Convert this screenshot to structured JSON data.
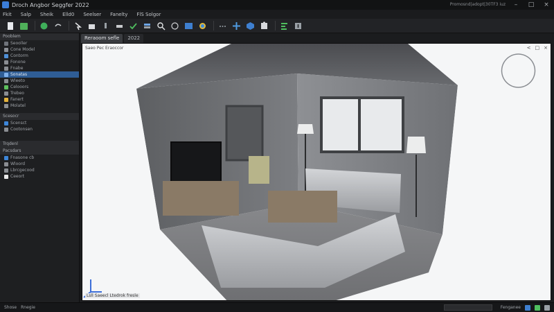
{
  "window": {
    "title": "Droch Angbor Seggfer 2022",
    "right_text": "Promosnd|adopt|30TF3 iuz"
  },
  "menu": {
    "items": [
      "Fkit",
      "Salp",
      "Sheik",
      "Elld0",
      "Seelser",
      "Fanelty",
      "FlS Solgor"
    ]
  },
  "sidebar": {
    "header1": "Pooblem",
    "rows_a": [
      {
        "label": "Seooller",
        "selected": false,
        "icon_color": "#6f737a"
      },
      {
        "label": "Cone Model",
        "selected": false,
        "icon_color": "#8d9096"
      },
      {
        "label": "Contorm",
        "selected": false,
        "icon_color": "#4f8fd6"
      },
      {
        "label": "Fonone",
        "selected": false,
        "icon_color": "#8a8d92"
      },
      {
        "label": "Fnabe",
        "selected": false,
        "icon_color": "#8a8d92"
      },
      {
        "label": "Sonatas",
        "selected": true,
        "icon_color": "#7fb0ea"
      },
      {
        "label": "Wleeto",
        "selected": false,
        "icon_color": "#8a8d92"
      },
      {
        "label": "Celooors",
        "selected": false,
        "icon_color": "#5ec05e"
      },
      {
        "label": "Trebeo",
        "selected": false,
        "icon_color": "#8a8d92"
      },
      {
        "label": "Fanert",
        "selected": false,
        "icon_color": "#e3b23c"
      },
      {
        "label": "Molatel",
        "selected": false,
        "icon_color": "#8a8d92"
      }
    ],
    "header2": "Scesocr",
    "rows_b": [
      {
        "label": "Scensct",
        "selected": false,
        "icon_color": "#3d86d9"
      },
      {
        "label": "Cootonsen",
        "selected": false,
        "icon_color": "#8a8d92"
      }
    ],
    "header3": "Trqdenl",
    "header4": "Pacsdars",
    "rows_c": [
      {
        "label": "Fnasone cb",
        "selected": false,
        "icon_color": "#3d86d9"
      },
      {
        "label": "Wloord",
        "selected": false,
        "icon_color": "#8a8d92"
      },
      {
        "label": "Lbrcgecood",
        "selected": false,
        "icon_color": "#8a8d92"
      },
      {
        "label": "Ceeort",
        "selected": false,
        "icon_color": "#e8e8e8"
      }
    ]
  },
  "tabs": [
    {
      "label": "Reraoom sefle",
      "active": true
    },
    {
      "label": "2022",
      "active": false
    }
  ],
  "viewport": {
    "label": "Saeo Pec Eraoccor",
    "coords": "Lsll Saeecl Ltedrok fresle",
    "controls": [
      "<",
      "□",
      "×"
    ]
  },
  "statusbar": {
    "left1": "Shose",
    "left2": "Rnegie",
    "right_label": "Fenganee"
  },
  "colors": {
    "accent": "#2f5d95",
    "selection": "#2f5d95",
    "background": "#1b1c1e"
  }
}
